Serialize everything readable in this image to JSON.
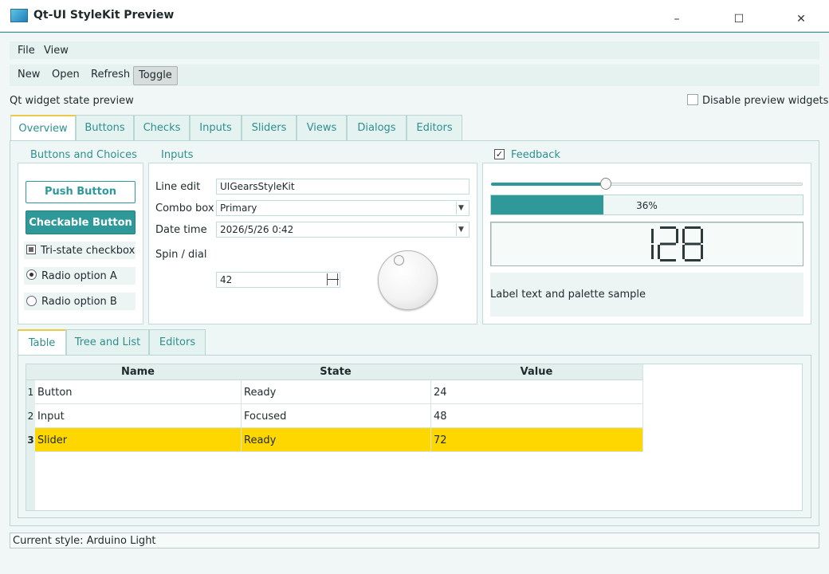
{
  "window": {
    "title": "Qt-UI StyleKit Preview",
    "minimize": "–",
    "maximize": "☐",
    "close": "✕"
  },
  "menu": [
    "File",
    "View"
  ],
  "toolbar": [
    "New",
    "Open",
    "Refresh",
    "Toggle"
  ],
  "state_label": "Qt widget state preview",
  "disable_preview": {
    "label": "Disable preview widgets",
    "checked": false
  },
  "main_tabs": [
    "Overview",
    "Buttons",
    "Checks",
    "Inputs",
    "Sliders",
    "Views",
    "Dialogs",
    "Editors"
  ],
  "active_main_tab": "Overview",
  "buttons_group": {
    "title": "Buttons and Choices",
    "push": "Push Button",
    "checkable": "Checkable Button",
    "tristate": "Tri-state checkbox",
    "radio_a": "Radio option A",
    "radio_b": "Radio option B",
    "radio_selected": "Radio option A"
  },
  "inputs_group": {
    "title": "Inputs",
    "line_edit_label": "Line edit",
    "line_edit_value": "UIGearsStyleKit",
    "combo_label": "Combo box",
    "combo_value": "Primary",
    "datetime_label": "Date time",
    "datetime_value": "2026/5/26 0:42",
    "spin_label": "Spin / dial",
    "spin_value": "42"
  },
  "feedback_group": {
    "title": "Feedback",
    "checked": true,
    "slider_fraction": 0.37,
    "progress_text": "36%",
    "progress_percent": 36,
    "lcd_value": "128",
    "label_text": "Label text and palette sample"
  },
  "inner_tabs": [
    "Table",
    "Tree and List",
    "Editors"
  ],
  "active_inner_tab": "Table",
  "table": {
    "headers": [
      "Name",
      "State",
      "Value"
    ],
    "rows": [
      {
        "num": "1",
        "name": "Button",
        "state": "Ready",
        "value": "24"
      },
      {
        "num": "2",
        "name": "Input",
        "state": "Focused",
        "value": "48"
      },
      {
        "num": "3",
        "name": "Slider",
        "state": "Ready",
        "value": "72"
      }
    ],
    "selected_row": "3",
    "selection_color": "#ffd700"
  },
  "status": "Current style: Arduino Light",
  "colors": {
    "accent": "#2f9999",
    "tab_highlight": "#e8c94a",
    "background": "#f1f7f6"
  }
}
